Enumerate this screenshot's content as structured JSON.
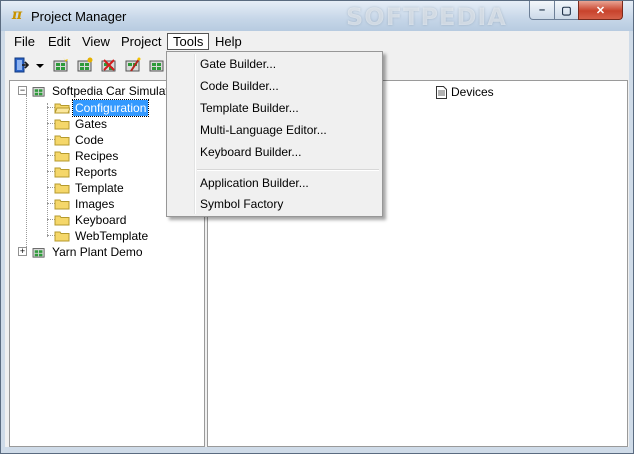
{
  "window": {
    "title": "Project Manager",
    "app_icon_glyph": "π",
    "watermark": "SOFTPEDIA"
  },
  "window_controls": {
    "minimize": "–",
    "maximize": "▢",
    "close": "✕"
  },
  "menubar": {
    "items": [
      "File",
      "Edit",
      "View",
      "Project",
      "Tools",
      "Help"
    ],
    "active": "Tools"
  },
  "toolbar": {
    "icons": [
      "exit-icon",
      "dropdown-arrow-icon",
      "project-icon",
      "project-open-icon",
      "project-delete-icon",
      "project-wizard-icon",
      "project-properties-icon"
    ]
  },
  "tools_menu": {
    "group1": [
      "Gate Builder...",
      "Code Builder...",
      "Template Builder...",
      "Multi-Language Editor...",
      "Keyboard Builder..."
    ],
    "group2": [
      "Application Builder...",
      "Symbol Factory"
    ]
  },
  "tree": {
    "root1": "Softpedia Car Simulation",
    "children": [
      "Configuration",
      "Gates",
      "Code",
      "Recipes",
      "Reports",
      "Template",
      "Images",
      "Keyboard",
      "WebTemplate"
    ],
    "root2": "Yarn Plant Demo",
    "selected": "Configuration"
  },
  "list": {
    "items": [
      "Devices"
    ]
  },
  "colors": {
    "selection": "#3399ff",
    "folder": "#f5d76a",
    "close_button": "#c8432c"
  }
}
